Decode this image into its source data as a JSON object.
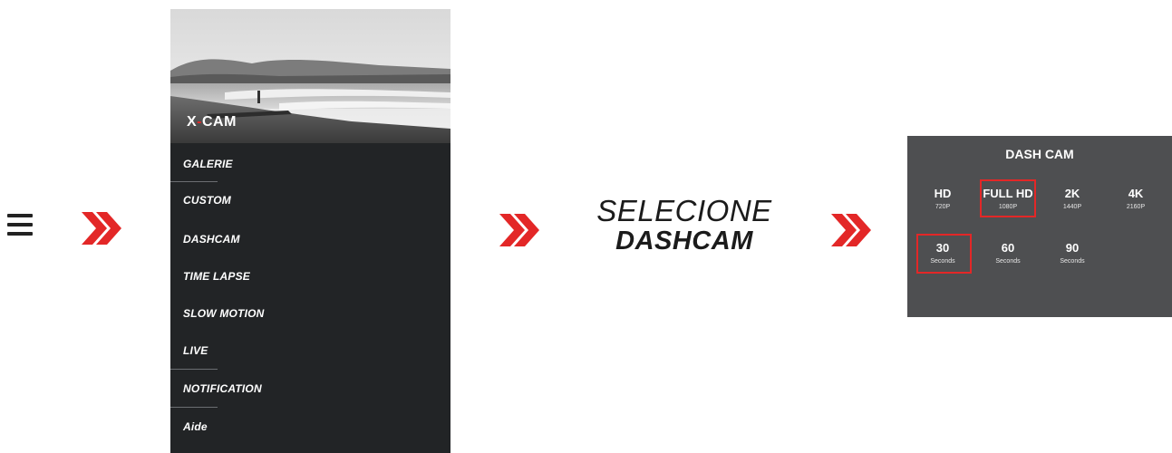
{
  "menu": {
    "app_title_x": "X",
    "app_title_cam": "CAM",
    "items": [
      {
        "label": "GALERIE"
      },
      {
        "label": "CUSTOM"
      },
      {
        "label": "DASHCAM"
      },
      {
        "label": "TIME LAPSE"
      },
      {
        "label": "SLOW MOTION"
      },
      {
        "label": "LIVE"
      },
      {
        "label": "NOTIFICATION"
      },
      {
        "label": "Aide"
      }
    ]
  },
  "caption": {
    "line1": "SELECIONE",
    "line2": "DASHCAM"
  },
  "dashcam": {
    "title": "DASH CAM",
    "resolutions": [
      {
        "label": "HD",
        "sub": "720P",
        "selected": false
      },
      {
        "label": "FULL HD",
        "sub": "1080P",
        "selected": true
      },
      {
        "label": "2K",
        "sub": "1440P",
        "selected": false
      },
      {
        "label": "4K",
        "sub": "2160P",
        "selected": false
      }
    ],
    "durations": [
      {
        "label": "30",
        "sub": "Seconds",
        "selected": true
      },
      {
        "label": "60",
        "sub": "Seconds",
        "selected": false
      },
      {
        "label": "90",
        "sub": "Seconds",
        "selected": false
      }
    ]
  },
  "colors": {
    "accent": "#e32727",
    "menu_bg": "#222426",
    "panel_bg": "#4e4f51"
  },
  "icons": [
    "menu-icon",
    "double-chevron-right-icon"
  ]
}
